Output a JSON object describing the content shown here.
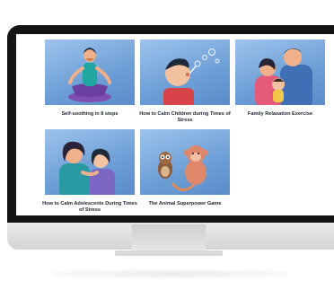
{
  "cards": [
    {
      "title": "Self-soothing in 8 steps",
      "illustration": "meditating-man"
    },
    {
      "title": "How to Calm Children during Times of Stress",
      "illustration": "child-blowing-bubbles"
    },
    {
      "title": "Family Relaxation Exercise",
      "illustration": "family-hug"
    },
    {
      "title": "How to Calm Adolescents During Times of Stress",
      "illustration": "mother-and-teen"
    },
    {
      "title": "The Animal Superpower Game",
      "illustration": "owl-and-monkey"
    }
  ],
  "colors": {
    "thumb_blue": "#7aa8dc",
    "bezel": "#141414",
    "caption": "#1c2430"
  }
}
